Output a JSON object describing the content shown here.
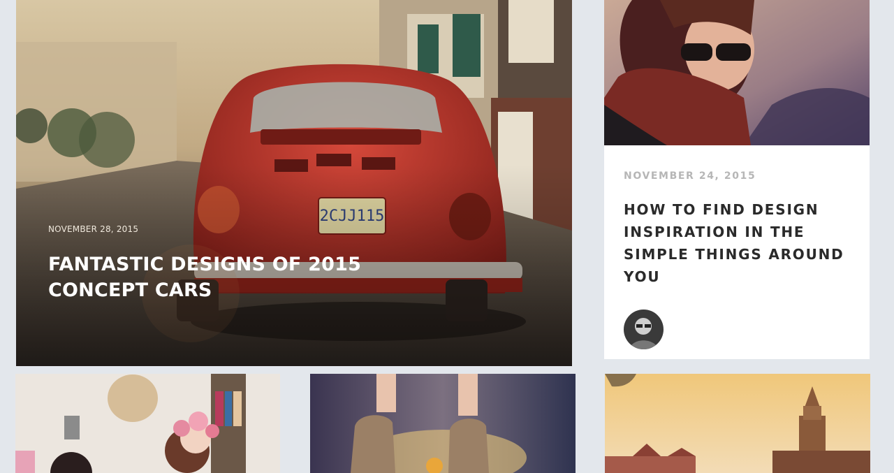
{
  "posts": {
    "featured": {
      "date": "NOVEMBER 28, 2015",
      "title": "FANTASTIC DESIGNS OF 2015 CONCEPT CARS",
      "image_icon": "red-beetle-car-photo",
      "plate_text": "2CJJ115"
    },
    "side": {
      "date": "NOVEMBER 24, 2015",
      "title": "HOW TO FIND DESIGN INSPIRATION IN THE SIMPLE THINGS AROUND YOU",
      "image_icon": "woman-sunglasses-scarf-photo",
      "author_icon": "author-avatar"
    },
    "tiles": [
      {
        "image_icon": "girls-flower-crown-photo"
      },
      {
        "image_icon": "boots-dandelion-photo"
      },
      {
        "image_icon": "city-tower-photo"
      }
    ]
  },
  "colors": {
    "background": "#e3e7ec",
    "card": "#ffffff",
    "title_dark": "#2a2a2a",
    "date_gray": "#b6b6b6"
  }
}
